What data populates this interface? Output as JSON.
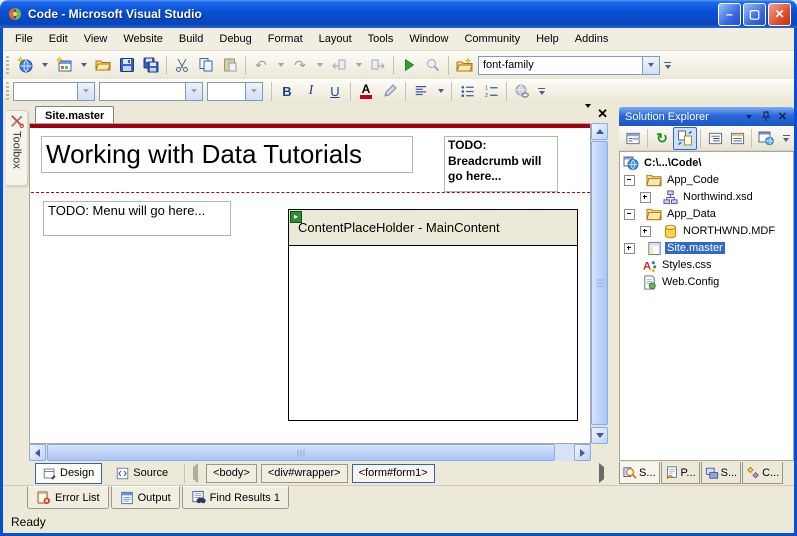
{
  "window": {
    "title": "Code - Microsoft Visual Studio"
  },
  "menu": {
    "items": [
      "File",
      "Edit",
      "View",
      "Website",
      "Build",
      "Debug",
      "Format",
      "Layout",
      "Tools",
      "Window",
      "Community",
      "Help",
      "Addins"
    ]
  },
  "toolbar": {
    "font_family_value": "font-family"
  },
  "format": {
    "bold_label": "B",
    "italic_label": "I",
    "underline_label": "U",
    "font_color_letter": "A"
  },
  "toolbox": {
    "label": "Toolbox"
  },
  "editor": {
    "tab_label": "Site.master",
    "heading": "Working with Data Tutorials",
    "breadcrumb_todo": "TODO: Breadcrumb will go here...",
    "menu_todo": "TODO: Menu will go here...",
    "content_placeholder": "ContentPlaceHolder - MainContent",
    "view_design": "Design",
    "view_source": "Source",
    "tags": [
      "<body>",
      "<div#wrapper>",
      "<form#form1>"
    ]
  },
  "solution_explorer": {
    "title": "Solution Explorer",
    "items": [
      {
        "label": "C:\\...\\Code\\"
      },
      {
        "label": "App_Code"
      },
      {
        "label": "Northwind.xsd"
      },
      {
        "label": "App_Data"
      },
      {
        "label": "NORTHWND.MDF"
      },
      {
        "label": "Site.master"
      },
      {
        "label": "Styles.css"
      },
      {
        "label": "Web.Config"
      }
    ],
    "bottom_tabs": [
      "S...",
      "P...",
      "S...",
      "C..."
    ]
  },
  "bottom_panel": {
    "tabs": [
      "Error List",
      "Output",
      "Find Results 1"
    ]
  },
  "statusbar": {
    "text": "Ready"
  }
}
